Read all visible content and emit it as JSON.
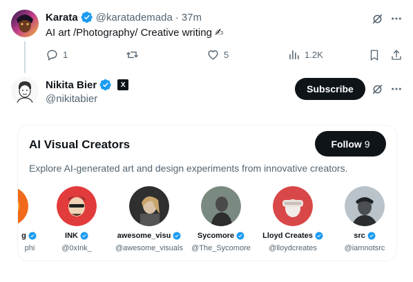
{
  "colors": {
    "accent": "#1d9bf0",
    "text_primary": "#0f1419",
    "text_secondary": "#536471",
    "button_dark": "#0f1419"
  },
  "tweet": {
    "author_name": "Karata",
    "author_handle": "@karatademada",
    "separator": "·",
    "time": "37m",
    "text": "AI art /Photography/ Creative writing ✍",
    "actions": {
      "replies": "1",
      "retweets": "",
      "likes": "5",
      "views": "1.2K"
    },
    "icons": [
      "grok-icon",
      "more-icon",
      "reply-icon",
      "retweet-icon",
      "like-icon",
      "views-icon",
      "bookmark-icon",
      "share-icon"
    ]
  },
  "profile": {
    "name": "Nikita Bier",
    "handle": "@nikitabier",
    "affiliate_badge": "X",
    "subscribe_label": "Subscribe"
  },
  "list_card": {
    "title": "AI Visual Creators",
    "follow_label": "Follow",
    "follow_count": "9",
    "description": "Explore AI-generated art and design experiments from innovative creators.",
    "creators": [
      {
        "name": "g",
        "handle": "phi",
        "avatar_color": "#f06a1a"
      },
      {
        "name": "INK",
        "handle": "@0xInk_",
        "avatar_color": "#e23b3b"
      },
      {
        "name": "awesome_visu",
        "handle": "@awesome_visuals",
        "avatar_color": "#3a3a3a"
      },
      {
        "name": "Sycomore",
        "handle": "@The_Sycomore",
        "avatar_color": "#7b8a80"
      },
      {
        "name": "Lloyd Creates",
        "handle": "@lloydcreates",
        "avatar_color": "#d84848"
      },
      {
        "name": "src",
        "handle": "@iamnotsrc",
        "avatar_color": "#b9c3c9"
      }
    ]
  }
}
